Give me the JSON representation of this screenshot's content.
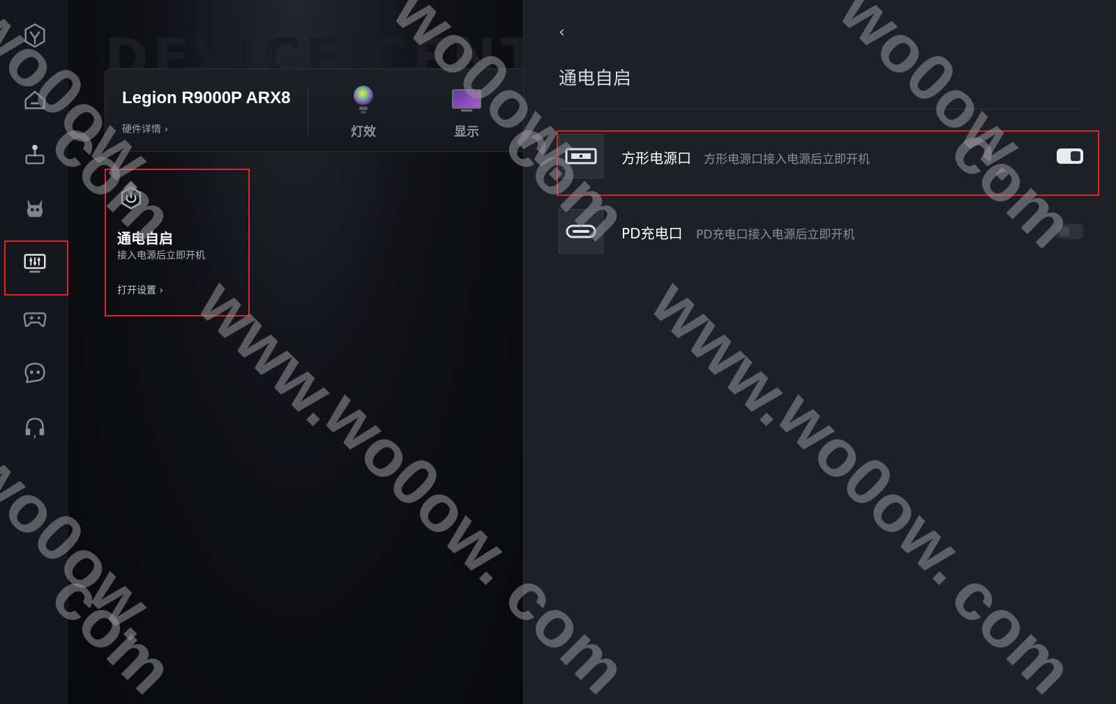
{
  "sidebar": {
    "items": [
      {
        "icon": "legion-logo-icon"
      },
      {
        "icon": "home-icon"
      },
      {
        "icon": "joystick-icon"
      },
      {
        "icon": "avatar-icon"
      },
      {
        "icon": "device-settings-icon"
      },
      {
        "icon": "gamepad-icon"
      },
      {
        "icon": "chat-icon"
      },
      {
        "icon": "headset-icon"
      }
    ],
    "active_index": 4
  },
  "middle": {
    "background_title": "DEVICE CENTER",
    "device_name": "Legion R9000P ARX8",
    "hardware_link": "硬件详情",
    "tiles": [
      {
        "label": "灯效",
        "icon": "lighting-icon"
      },
      {
        "label": "显示",
        "icon": "display-icon"
      }
    ],
    "feature_card": {
      "title": "通电自启",
      "description": "接入电源后立即开机",
      "link": "打开设置",
      "icon": "power-icon"
    }
  },
  "panel": {
    "back_icon": "chevron-left-icon",
    "title": "通电自启",
    "rows": [
      {
        "name": "方形电源口",
        "description": "方形电源口接入电源后立即开机",
        "enabled": true,
        "icon": "square-port-icon"
      },
      {
        "name": "PD充电口",
        "description": "PD充电口接入电源后立即开机",
        "enabled": false,
        "icon": "usb-c-port-icon"
      }
    ]
  },
  "watermark": {
    "text_www": "www.",
    "text_mid": "wo0ow.",
    "text_com": "com"
  },
  "colors": {
    "highlight": "#e0222b",
    "panel_bg": "#1d2026",
    "rail_bg": "#15171c"
  }
}
